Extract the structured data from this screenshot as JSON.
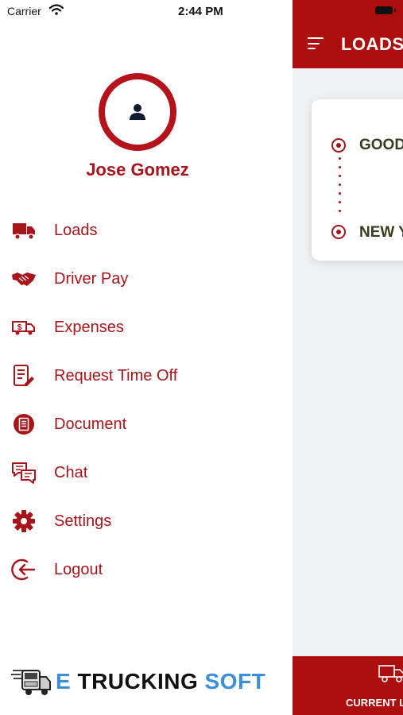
{
  "status_bar": {
    "carrier": "Carrier",
    "time": "2:44 PM"
  },
  "drawer": {
    "user_name": "Jose Gomez",
    "menu": [
      {
        "label": "Loads",
        "icon": "truck-icon"
      },
      {
        "label": "Driver Pay",
        "icon": "handshake-icon"
      },
      {
        "label": "Expenses",
        "icon": "money-truck-icon"
      },
      {
        "label": "Request Time Off",
        "icon": "request-form-icon"
      },
      {
        "label": "Document",
        "icon": "document-icon"
      },
      {
        "label": "Chat",
        "icon": "chat-icon"
      },
      {
        "label": "Settings",
        "icon": "gear-icon"
      },
      {
        "label": "Logout",
        "icon": "logout-icon"
      }
    ],
    "logo": {
      "e": "E",
      "trucking": "TRUCKING",
      "soft": "SOFT"
    }
  },
  "app": {
    "title": "LOADS",
    "card": {
      "origin": "GOOD",
      "destination": "NEW Y"
    },
    "footer_tab": "CURRENT L"
  },
  "colors": {
    "primary": "#ad0e0e",
    "accent_text": "#a8141b",
    "logo_blue": "#3c8fd6",
    "background": "#eef0f3"
  }
}
